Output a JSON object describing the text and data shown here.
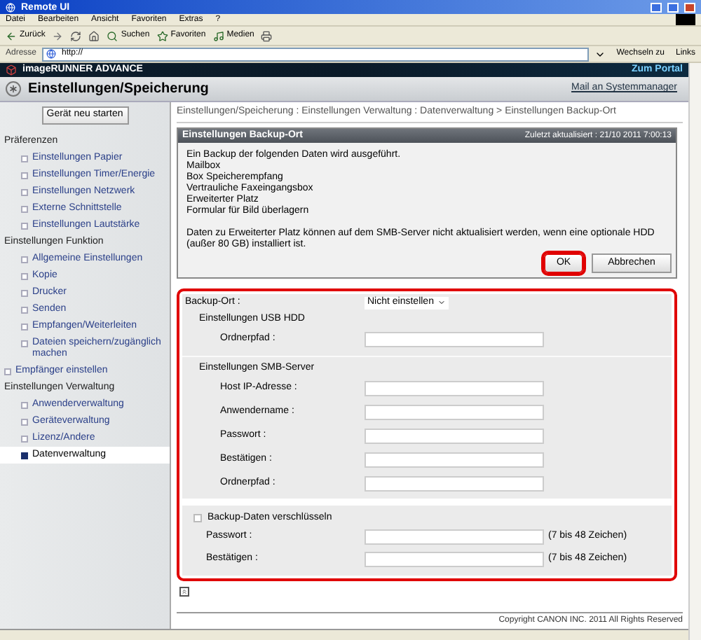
{
  "window": {
    "title": "Remote UI"
  },
  "menu": [
    "Datei",
    "Bearbeiten",
    "Ansicht",
    "Favoriten",
    "Extras",
    "?"
  ],
  "toolbar": [
    {
      "kind": "back",
      "label": "Zurück"
    },
    {
      "kind": "search",
      "label": "Suchen"
    },
    {
      "kind": "favorites",
      "label": "Favoriten"
    },
    {
      "kind": "media",
      "label": "Medien"
    }
  ],
  "address_bar": {
    "label": "Adresse",
    "value": "http://",
    "go": "Wechseln zu",
    "links": "Links"
  },
  "app_header": {
    "product": "imageRUNNER ADVANCE",
    "portal": "Zum Portal"
  },
  "page_header": {
    "title": "Einstellungen/Speicherung",
    "mail": "Mail an Systemmanager"
  },
  "sidebar": {
    "restart": "Gerät neu starten",
    "entries": [
      {
        "kind": "heading",
        "label": "Präferenzen",
        "children": [
          {
            "label": "Einstellungen Papier",
            "selected": false
          },
          {
            "label": "Einstellungen Timer/Energie",
            "selected": false
          },
          {
            "label": "Einstellungen Netzwerk",
            "selected": false
          },
          {
            "label": "Externe Schnittstelle",
            "selected": false
          },
          {
            "label": "Einstellungen Lautstärke",
            "selected": false
          }
        ]
      },
      {
        "kind": "heading",
        "label": "Einstellungen Funktion",
        "children": [
          {
            "label": "Allgemeine Einstellungen",
            "selected": false
          },
          {
            "label": "Kopie",
            "selected": false
          },
          {
            "label": "Drucker",
            "selected": false
          },
          {
            "label": "Senden",
            "selected": false
          },
          {
            "label": "Empfangen/Weiterleiten",
            "selected": false
          },
          {
            "label": "Dateien speichern/zugänglich machen",
            "selected": false
          }
        ]
      },
      {
        "kind": "link",
        "label": "Empfänger einstellen",
        "selected": false
      },
      {
        "kind": "heading",
        "label": "Einstellungen Verwaltung",
        "children": [
          {
            "label": "Anwenderverwaltung",
            "selected": false
          },
          {
            "label": "Geräteverwaltung",
            "selected": false
          },
          {
            "label": "Lizenz/Andere",
            "selected": false
          },
          {
            "label": "Datenverwaltung",
            "selected": true
          }
        ]
      }
    ]
  },
  "breadcrumb": "Einstellungen/Speicherung : Einstellungen Verwaltung : Datenverwaltung > Einstellungen Backup-Ort",
  "dialog": {
    "title": "Einstellungen Backup-Ort",
    "updated": "Zuletzt aktualisiert : 21/10 2011 7:00:13",
    "lines": [
      "Ein Backup der folgenden Daten wird ausgeführt.",
      "Mailbox",
      "Box Speicherempfang",
      "Vertrauliche Faxeingangsbox",
      "Erweiterter Platz",
      "Formular für Bild überlagern"
    ],
    "note": "Daten zu Erweiterter Platz können auf dem SMB-Server nicht aktualisiert werden, wenn eine optionale HDD (außer 80 GB) installiert ist.",
    "buttons": [
      {
        "label": "OK",
        "highlighted": true
      },
      {
        "label": "Abbrechen",
        "highlighted": false
      }
    ]
  },
  "form": {
    "highlighted": true,
    "backup_location": {
      "label": "Backup-Ort :",
      "value": "Nicht einstellen"
    },
    "groups": [
      {
        "title": "Einstellungen USB HDD",
        "fields": [
          {
            "label": "Ordnerpfad :"
          }
        ]
      },
      {
        "title": "Einstellungen SMB-Server",
        "fields": [
          {
            "label": "Host IP-Adresse :"
          },
          {
            "label": "Anwendername :"
          },
          {
            "label": "Passwort :"
          },
          {
            "label": "Bestätigen :"
          },
          {
            "label": "Ordnerpfad :"
          }
        ]
      }
    ],
    "encrypt": {
      "label": "Backup-Daten verschlüsseln",
      "checked": false,
      "fields": [
        {
          "label": "Passwort :",
          "hint": "(7 bis 48 Zeichen)"
        },
        {
          "label": "Bestätigen :",
          "hint": "(7 bis 48 Zeichen)"
        }
      ]
    }
  },
  "footer": "Copyright CANON INC. 2011 All Rights Reserved"
}
